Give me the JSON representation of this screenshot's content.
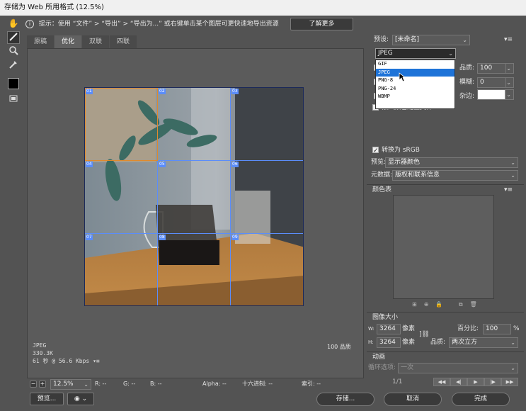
{
  "window": {
    "title": "存储为 Web 所用格式 (12.5%)"
  },
  "hint": {
    "text": "提示：使用 “文件” > “导出” > “导出为...” 或右键单击某个图层可更快速地导出资源",
    "learn_more": "了解更多"
  },
  "tabs": [
    "原稿",
    "优化",
    "双联",
    "四联"
  ],
  "slices": [
    "01",
    "02",
    "03",
    "04",
    "05",
    "06",
    "07",
    "08",
    "09"
  ],
  "image_info": {
    "format": "JPEG",
    "size": "330.3K",
    "time": "61 秒 @ 56.6 Kbps",
    "quality": "100 品质"
  },
  "status": {
    "zoom": "12.5%",
    "r": "R: --",
    "g": "G: --",
    "b": "B: --",
    "alpha": "Alpha: --",
    "hex": "十六进制: --",
    "index": "索引: --"
  },
  "buttons": {
    "preview": "预览...",
    "save": "存储...",
    "cancel": "取消",
    "done": "完成"
  },
  "panel": {
    "preset_label": "预设:",
    "preset_value": "[未命名]",
    "format_value": "JPEG",
    "format_options": [
      "GIF",
      "JPEG",
      "PNG-8",
      "PNG-24",
      "WBMP"
    ],
    "quality_label": "品质:",
    "quality_value": "100",
    "blur_label": "模糊:",
    "blur_value": "0",
    "matte_label": "杂边:",
    "embed_profile": "嵌入颜色配置文件",
    "convert_srgb": "转换为 sRGB",
    "preview_label": "预览:",
    "preview_value": "显示器颜色",
    "metadata_label": "元数据:",
    "metadata_value": "版权和联系信息",
    "color_table": "颜色表",
    "image_size": "图像大小",
    "w_label": "W:",
    "w_value": "3264",
    "h_label": "H:",
    "h_value": "3264",
    "px": "像素",
    "percent_label": "百分比:",
    "percent_value": "100",
    "percent_unit": "%",
    "quality2_label": "品质:",
    "quality2_value": "两次立方",
    "animation": "动画",
    "loop_label": "循环选项:",
    "loop_value": "一次",
    "frame": "1/1"
  }
}
